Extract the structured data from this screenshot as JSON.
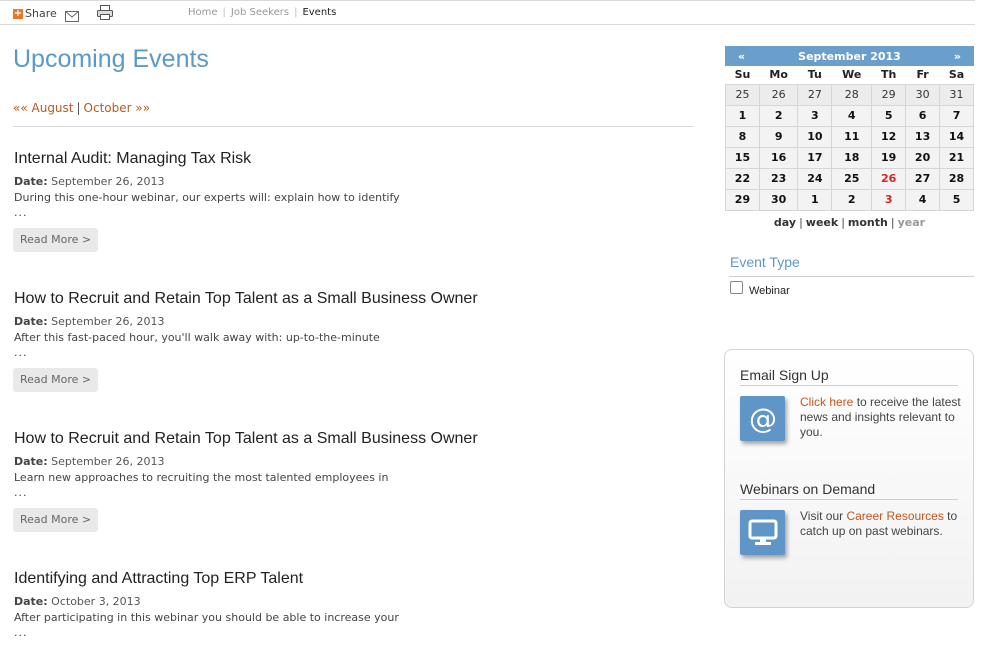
{
  "topbar": {
    "share_label": "Share",
    "icons": [
      "share-icon",
      "mail-icon",
      "print-icon"
    ],
    "breadcrumb": [
      "Home",
      "Job Seekers",
      "Events"
    ]
  },
  "main": {
    "title": "Upcoming Events",
    "prev_month": "«« August",
    "next_month": "October »»",
    "events": [
      {
        "title": "Internal Audit: Managing Tax Risk",
        "date_label": "Date:",
        "date": "September 26, 2013",
        "description": "During this one-hour webinar, our experts will: explain how to identify",
        "ellipsis": "...",
        "read_more": "Read More >"
      },
      {
        "title": "How to Recruit and Retain Top Talent as a Small Business Owner",
        "date_label": "Date:",
        "date": "September 26, 2013",
        "description": "After this fast-paced hour, you'll walk away with: up-to-the-minute",
        "ellipsis": "...",
        "read_more": "Read More >"
      },
      {
        "title": "How to Recruit and Retain Top Talent as a Small Business Owner",
        "date_label": "Date:",
        "date": "September 26, 2013",
        "description": "Learn new approaches to recruiting the most talented employees in",
        "ellipsis": "...",
        "read_more": "Read More >"
      },
      {
        "title": "Identifying and Attracting Top ERP Talent",
        "date_label": "Date:",
        "date": "October 3, 2013",
        "description": "After participating in this webinar you should be able to increase your",
        "ellipsis": "..."
      }
    ]
  },
  "calendar": {
    "prev": "«",
    "next": "»",
    "month": "September 2013",
    "weekdays": [
      "Su",
      "Mo",
      "Tu",
      "We",
      "Th",
      "Fr",
      "Sa"
    ],
    "weeks": [
      [
        "25",
        "26",
        "27",
        "28",
        "29",
        "30",
        "31"
      ],
      [
        "1",
        "2",
        "3",
        "4",
        "5",
        "6",
        "7"
      ],
      [
        "8",
        "9",
        "10",
        "11",
        "12",
        "13",
        "14"
      ],
      [
        "15",
        "16",
        "17",
        "18",
        "19",
        "20",
        "21"
      ],
      [
        "22",
        "23",
        "24",
        "25",
        "26",
        "27",
        "28"
      ],
      [
        "29",
        "30",
        "1",
        "2",
        "3",
        "4",
        "5"
      ]
    ],
    "highlight_color": "#dd2222",
    "views": [
      "day",
      "week",
      "month",
      "year"
    ]
  },
  "event_type": {
    "title": "Event Type",
    "option": "Webinar",
    "checked": false
  },
  "promo": {
    "signup_title": "Email Sign Up",
    "signup_link": "Click here",
    "signup_text": " to receive the latest news and insights relevant to you.",
    "signup_icon": "at-icon",
    "webinars_title": "Webinars on Demand",
    "webinars_pre": "Visit our ",
    "webinars_link": "Career Resources",
    "webinars_text": " to catch up on past webinars.",
    "webinars_icon": "monitor-icon"
  },
  "colors": {
    "heading_blue": "#5b9ac6",
    "calendar_header": "#6b9fcb",
    "link_orange": "#c2571b"
  }
}
